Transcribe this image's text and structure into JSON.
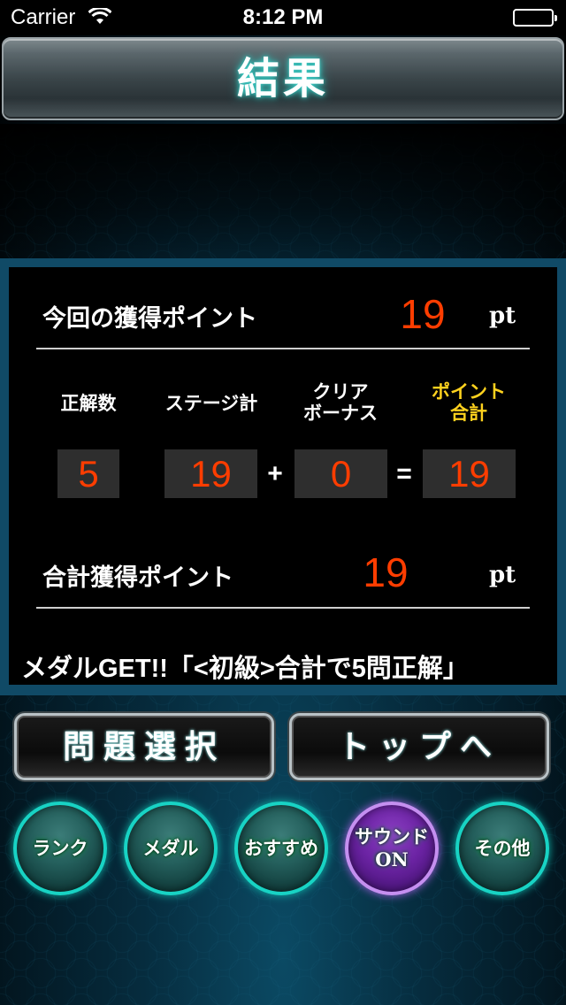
{
  "status_bar": {
    "carrier": "Carrier",
    "time": "8:12 PM"
  },
  "header": {
    "title": "結果"
  },
  "results": {
    "current_points_label": "今回の獲得ポイント",
    "current_points_value": "19",
    "unit": "pt",
    "columns": {
      "correct_count": "正解数",
      "stage_total": "ステージ計",
      "clear_bonus_line1": "クリア",
      "clear_bonus_line2": "ボーナス",
      "point_total_line1": "ポイント",
      "point_total_line2": "合計"
    },
    "values": {
      "correct_count": "5",
      "stage_total": "19",
      "plus": "+",
      "clear_bonus": "0",
      "equals": "=",
      "point_total": "19"
    },
    "total_points_label": "合計獲得ポイント",
    "total_points_value": "19",
    "medal_message": "メダルGET!!「<初級>合計で5問正解」"
  },
  "buttons": {
    "select_problem": "問題選択",
    "to_top": "トップへ"
  },
  "menu": {
    "rank": "ランク",
    "medal": "メダル",
    "recommend": "おすすめ",
    "sound_line1": "サウンド",
    "sound_line2": "ON",
    "other": "その他"
  },
  "colors": {
    "accent_orange": "#ff3d00",
    "gold": "#ffd21e",
    "teal": "#18d3c4",
    "purple": "#6b23a3"
  }
}
